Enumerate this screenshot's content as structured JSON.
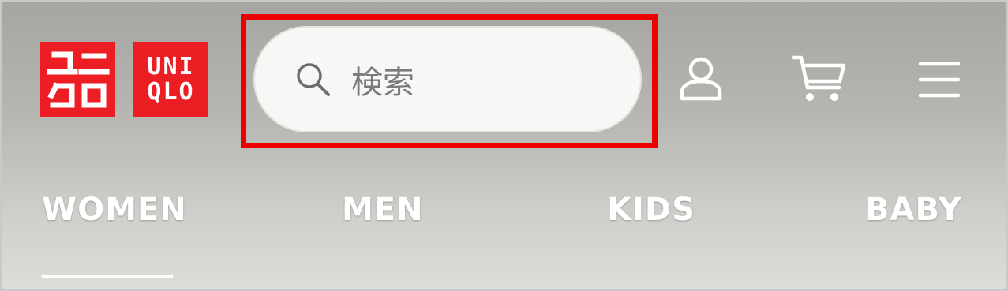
{
  "brand": {
    "logo_en_line1": "UNI",
    "logo_en_line2": "QLO",
    "logo_ja_text": "ユニクロ",
    "color": "#ed1d24"
  },
  "search": {
    "placeholder": "検索",
    "icon": "search-icon"
  },
  "header_icons": [
    "user-icon",
    "cart-icon",
    "menu-icon"
  ],
  "nav": {
    "tabs": [
      {
        "label": "WOMEN",
        "active": true
      },
      {
        "label": "MEN",
        "active": false
      },
      {
        "label": "KIDS",
        "active": false
      },
      {
        "label": "BABY",
        "active": false
      }
    ]
  },
  "annotation": {
    "highlight_color": "#ee0000",
    "highlighted_element": "search-input"
  }
}
